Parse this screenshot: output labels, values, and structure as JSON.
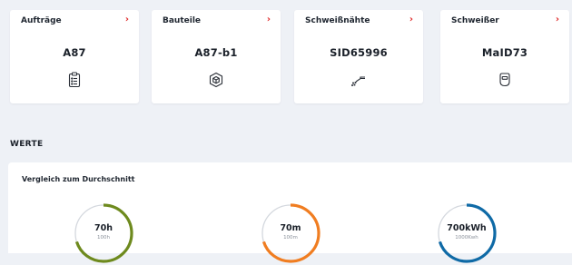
{
  "cards": [
    {
      "title": "Aufträge",
      "value": "A87",
      "icon": "clipboard-list-icon",
      "arrow": "›"
    },
    {
      "title": "Bauteile",
      "value": "A87-b1",
      "icon": "cube-icon",
      "arrow": "›"
    },
    {
      "title": "Schweißnähte",
      "value": "SID65996",
      "icon": "weld-seam-icon",
      "arrow": "›"
    },
    {
      "title": "Schweißer",
      "value": "MaID73",
      "icon": "welding-helmet-icon",
      "arrow": "›"
    }
  ],
  "section": {
    "title": "WERTE"
  },
  "panel": {
    "title": "Vergleich zum Durchschnitt",
    "gauges": [
      {
        "value": "70h",
        "reference": "100h",
        "fraction": 0.7,
        "color": "#6e8a1e"
      },
      {
        "value": "70m",
        "reference": "100m",
        "fraction": 0.7,
        "color": "#f07d21"
      },
      {
        "value": "700kWh",
        "reference": "1000Kwh",
        "fraction": 0.7,
        "color": "#0f6aa6"
      }
    ]
  },
  "colors": {
    "accent": "#e02a2a",
    "background": "#eef1f6"
  }
}
